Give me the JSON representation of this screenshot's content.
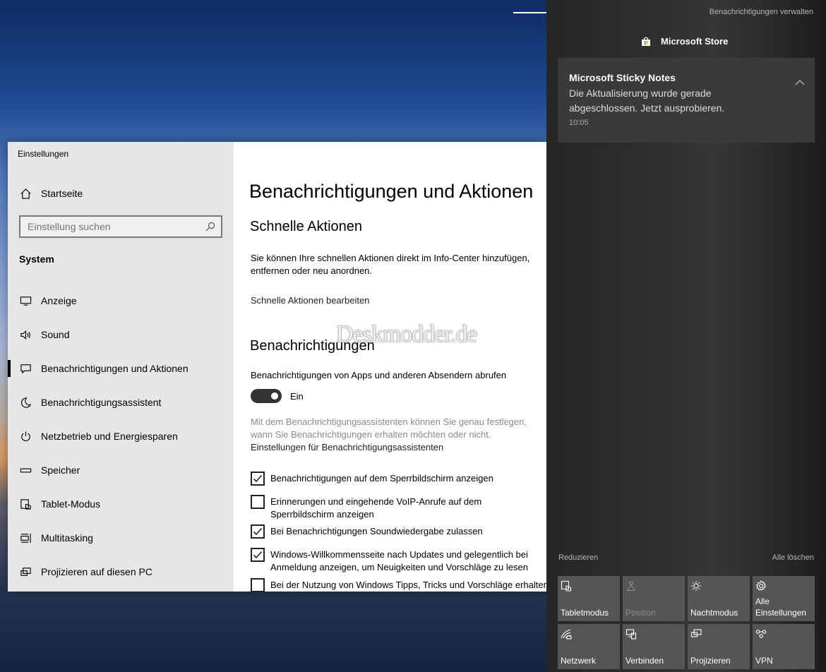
{
  "desktop": {
    "watermark": "Deskmodder.de"
  },
  "settings": {
    "window_title": "Einstellungen",
    "home_label": "Startseite",
    "search": {
      "placeholder": "Einstellung suchen"
    },
    "section": "System",
    "nav": [
      {
        "label": "Anzeige",
        "icon": "monitor-icon"
      },
      {
        "label": "Sound",
        "icon": "speaker-icon"
      },
      {
        "label": "Benachrichtigungen und Aktionen",
        "icon": "notification-icon",
        "active": true
      },
      {
        "label": "Benachrichtigungsassistent",
        "icon": "moon-icon"
      },
      {
        "label": "Netzbetrieb und Energiesparen",
        "icon": "power-icon"
      },
      {
        "label": "Speicher",
        "icon": "storage-icon"
      },
      {
        "label": "Tablet-Modus",
        "icon": "tablet-mode-icon"
      },
      {
        "label": "Multitasking",
        "icon": "multitasking-icon"
      },
      {
        "label": "Projizieren auf diesen PC",
        "icon": "project-icon"
      }
    ],
    "content": {
      "page_title": "Benachrichtigungen und Aktionen",
      "quick_actions_heading": "Schnelle Aktionen",
      "quick_actions_desc_1": "Sie können Ihre schnellen Aktionen direkt im Info-Center hinzufügen,",
      "quick_actions_desc_2": "entfernen oder neu anordnen.",
      "quick_actions_link": "Schnelle Aktionen bearbeiten",
      "notifications_heading": "Benachrichtigungen",
      "get_notifications_label": "Benachrichtigungen von Apps und anderen Absendern abrufen",
      "toggle_state": "Ein",
      "assistant_desc_1": "Mit dem Benachrichtigungsassistenten können Sie genau festlegen,",
      "assistant_desc_2": "wann Sie Benachrichtigungen erhalten möchten oder nicht.",
      "assistant_link": "Einstellungen für Benachrichtigungsassistenten",
      "checkboxes": [
        {
          "line1": "Benachrichtigungen auf dem Sperrbildschirm anzeigen",
          "line2": "",
          "checked": true
        },
        {
          "line1": "Erinnerungen und eingehende VoIP-Anrufe auf dem",
          "line2": "Sperrbildschirm anzeigen",
          "checked": false
        },
        {
          "line1": "Bei Benachrichtigungen Soundwiedergabe zulassen",
          "line2": "",
          "checked": true
        },
        {
          "line1": "Windows-Willkommensseite nach Updates und gelegentlich bei",
          "line2": "Anmeldung anzeigen, um Neuigkeiten und Vorschläge zu lesen",
          "checked": true
        },
        {
          "line1": "Bei der Nutzung von Windows Tipps, Tricks und Vorschläge erhalten",
          "line2": "",
          "checked": false
        }
      ]
    }
  },
  "action_center": {
    "manage_link": "Benachrichtigungen verwalten",
    "group_title": "Microsoft Store",
    "notification": {
      "title": "Microsoft Sticky Notes",
      "body": "Die Aktualisierung wurde gerade abgeschlossen. Jetzt ausprobieren.",
      "time": "10:05"
    },
    "collapse_label": "Reduzieren",
    "clear_all_label": "Alle löschen",
    "tiles": [
      {
        "label": "Tabletmodus",
        "icon": "tablet-mode-icon",
        "enabled": true
      },
      {
        "label": "Position",
        "icon": "location-icon",
        "enabled": false
      },
      {
        "label": "Nachtmodus",
        "icon": "night-light-icon",
        "enabled": true
      },
      {
        "label": "Alle Einstellungen",
        "icon": "gear-icon",
        "enabled": true
      },
      {
        "label": "Netzwerk",
        "icon": "network-icon",
        "enabled": true
      },
      {
        "label": "Verbinden",
        "icon": "connect-icon",
        "enabled": true
      },
      {
        "label": "Projizieren",
        "icon": "project-icon",
        "enabled": true
      },
      {
        "label": "VPN",
        "icon": "vpn-icon",
        "enabled": true
      }
    ]
  }
}
